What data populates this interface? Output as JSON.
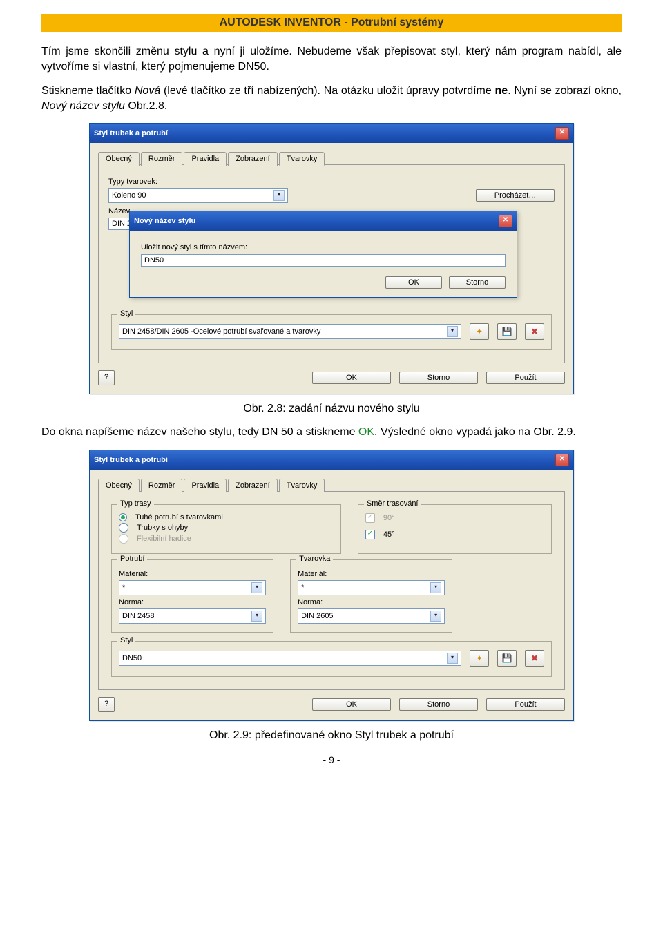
{
  "header": {
    "title": "AUTODESK INVENTOR - Potrubní systémy"
  },
  "page_number": "- 9 -",
  "paragraphs": {
    "p1_a": "Tím jsme skončili změnu stylu a nyní ji uložíme. Nebudeme však přepisovat styl, který nám program nabídl, ale vytvoříme si vlastní, který pojmenujeme DN50.",
    "p2_a": "Stiskneme tlačítko ",
    "p2_nova": "Nová",
    "p2_b": " (levé tlačítko ze tří nabízených). Na otázku uložit úpravy potvrdíme ",
    "p2_ne": "ne",
    "p2_c": ". Nyní se zobrazí okno, ",
    "p2_ital": "Nový název stylu",
    "p2_d": " Obr.2.8.",
    "caption1": "Obr. 2.8: zadání názvu nového stylu",
    "p3_a": "Do okna napíšeme název našeho stylu, tedy DN 50 a stiskneme ",
    "p3_ok": "OK",
    "p3_b": ". Výsledné okno vypadá jako na Obr. 2.9.",
    "caption2": "Obr. 2.9: předefinované okno Styl trubek a potrubí"
  },
  "dialog1": {
    "title": "Styl trubek a potrubí",
    "tabs": [
      "Obecný",
      "Rozměr",
      "Pravidla",
      "Zobrazení",
      "Tvarovky"
    ],
    "active_tab": 4,
    "types_label": "Typy tvarovek:",
    "types_value": "Koleno 90",
    "browse_label": "Procházet…",
    "name_label": "Název",
    "name_value_cut": "DIN 2",
    "style_legend": "Styl",
    "style_value": "DIN 2458/DIN 2605 -Ocelové potrubí svařované a tvarovky",
    "ok": "OK",
    "storno": "Storno",
    "pouzit": "Použít",
    "help": "?"
  },
  "inner_dialog": {
    "title": "Nový název stylu",
    "prompt": "Uložit nový styl s tímto názvem:",
    "value": "DN50",
    "ok": "OK",
    "storno": "Storno"
  },
  "dialog2": {
    "title": "Styl trubek a potrubí",
    "tabs": [
      "Obecný",
      "Rozměr",
      "Pravidla",
      "Zobrazení",
      "Tvarovky"
    ],
    "active_tab": 0,
    "typ_trasy_legend": "Typ trasy",
    "radio1": "Tuhé potrubí s tvarovkami",
    "radio2": "Trubky s ohyby",
    "radio3": "Flexibilní hadice",
    "smer_legend": "Směr trasování",
    "angle90": "90°",
    "angle45": "45°",
    "potrubi_legend": "Potrubí",
    "tvarovka_legend": "Tvarovka",
    "material_label": "Materiál:",
    "star": "*",
    "norma_label": "Norma:",
    "norma1": "DIN 2458",
    "norma2": "DIN 2605",
    "style_legend": "Styl",
    "style_value": "DN50",
    "ok": "OK",
    "storno": "Storno",
    "pouzit": "Použít",
    "help": "?"
  }
}
